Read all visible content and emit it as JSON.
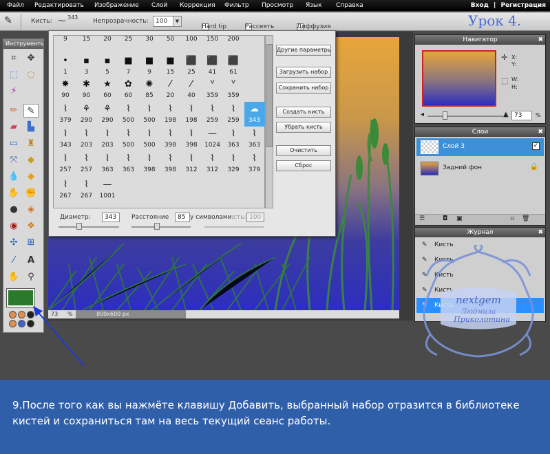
{
  "menu": {
    "items": [
      "Файл",
      "Редактировать",
      "Изображение",
      "Слой",
      "Коррекция",
      "Фильтр",
      "Просмотр",
      "Язык",
      "Справка"
    ],
    "login": "Вход",
    "separator": "|",
    "register": "Регистрация"
  },
  "options": {
    "brush_label": "Кисть:",
    "brush_size": "343",
    "opacity_label": "Непрозрачность:",
    "opacity_value": "100",
    "hard_tip": "Hard tip",
    "scatter": "Рассеять",
    "diffusion": "Диффузия"
  },
  "lesson_title": "Урок 4.",
  "toolbox": {
    "title": "Инструменты"
  },
  "brush_panel": {
    "rows": [
      [
        "9",
        "15",
        "20",
        "25",
        "30",
        "50",
        "100",
        "150",
        "200"
      ],
      [
        "1",
        "3",
        "5",
        "7",
        "9",
        "15",
        "25",
        "41",
        "61"
      ],
      [
        "90",
        "90",
        "60",
        "60",
        "85",
        "20",
        "40",
        "359",
        "359"
      ],
      [
        "379",
        "290",
        "290",
        "500",
        "500",
        "198",
        "198",
        "259",
        "259",
        "343"
      ],
      [
        "343",
        "203",
        "203",
        "500",
        "500",
        "398",
        "398",
        "1024",
        "363",
        "363"
      ],
      [
        "257",
        "257",
        "363",
        "363",
        "398",
        "398",
        "312",
        "312",
        "329",
        "379"
      ],
      [
        "267",
        "267",
        "1001"
      ]
    ],
    "buttons": {
      "more_params": "Другие параметры",
      "load_set": "Загрузить набор",
      "save_set": "Сохранить набор",
      "create_brush": "Создать кисть",
      "remove_brush": "Убрать кисть",
      "clear": "Очистить",
      "reset": "Сброс"
    },
    "diameter_label": "Диаметр:",
    "diameter_value": "343",
    "spacing_label": "Расстояние",
    "spacing_value": "85",
    "symbols_label": "у символами:",
    "opacity_label": "сть:",
    "opacity_value": "100"
  },
  "status": {
    "zoom": "73",
    "unit": "%",
    "dimensions": "800x600 px"
  },
  "navigator": {
    "title": "Навигатор",
    "x_label": "X:",
    "y_label": "Y:",
    "w_label": "W:",
    "h_label": "H:",
    "zoom": "73",
    "unit": "%"
  },
  "layers": {
    "title": "Слои",
    "items": [
      {
        "name": "Слой 3"
      },
      {
        "name": "Задний фон"
      }
    ]
  },
  "history": {
    "title": "Журнал",
    "items": [
      "Кисть",
      "Кисть",
      "Кисть",
      "Кисть",
      "Кисть"
    ]
  },
  "watermark": {
    "name": "nextgem",
    "sub1": "Людмила",
    "sub2": "Приколотина"
  },
  "caption": "9.После того как вы нажмёте клавишу Добавить, выбранный набор отразится в библиотеке кистей и сохраниться там на весь текущий сеанс работы.",
  "colors": {
    "caption_bg": "#305fa9",
    "selection": "#4ba8e8",
    "lesson": "#4a6bd6",
    "grass": "#3a8a3a"
  }
}
